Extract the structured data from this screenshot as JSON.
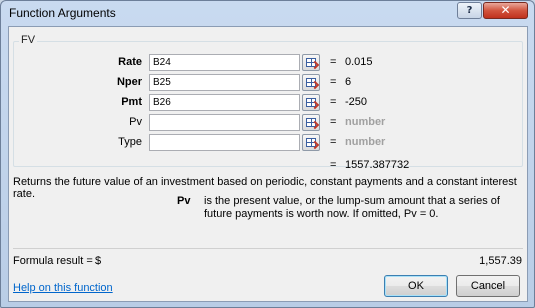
{
  "window": {
    "title": "Function Arguments",
    "help_glyph": "?",
    "close_glyph": "✕"
  },
  "group": {
    "label": "FV"
  },
  "arguments": [
    {
      "label": "Rate",
      "value": "B24",
      "equals": "=",
      "result": "0.015",
      "required": true
    },
    {
      "label": "Nper",
      "value": "B25",
      "equals": "=",
      "result": "6",
      "required": true
    },
    {
      "label": "Pmt",
      "value": "B26",
      "equals": "=",
      "result": "-250",
      "required": true
    },
    {
      "label": "Pv",
      "value": "",
      "equals": "=",
      "result": "number",
      "required": false
    },
    {
      "label": "Type",
      "value": "",
      "equals": "=",
      "result": "number",
      "required": false
    }
  ],
  "result": {
    "equals": "=",
    "value": "1557.387732"
  },
  "description": "Returns the future value of an investment based on periodic, constant payments and a constant interest rate.",
  "argument_help": {
    "name": "Pv",
    "text": "is the present value, or the lump-sum amount that a series of future payments is worth now. If omitted, Pv = 0."
  },
  "formula": {
    "label": "Formula result =",
    "currency": "$",
    "value": "1,557.39"
  },
  "footer": {
    "help_link": "Help on this function",
    "ok_label": "OK",
    "cancel_label": "Cancel"
  },
  "colors": {
    "accent_link": "#0066cc",
    "close_button": "#c0321e",
    "placeholder_text": "#a0a0a0"
  }
}
